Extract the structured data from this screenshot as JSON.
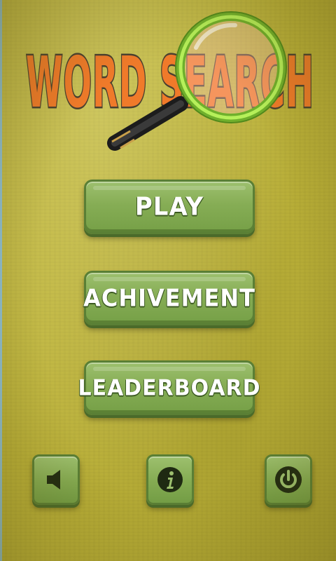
{
  "title": {
    "line": "WORD SEARCH"
  },
  "menu": {
    "play_label": "PLAY",
    "achievement_label": "ACHIVEMENT",
    "leaderboard_label": "LEADERBOARD"
  },
  "bottom_bar": {
    "sound_icon": "speaker-icon",
    "info_icon": "info-icon",
    "exit_icon": "power-icon"
  },
  "colors": {
    "background": "#bdb33a",
    "button_green": "#86ad55",
    "title_orange": "#f07a2a",
    "lens_green": "#9be04a"
  }
}
